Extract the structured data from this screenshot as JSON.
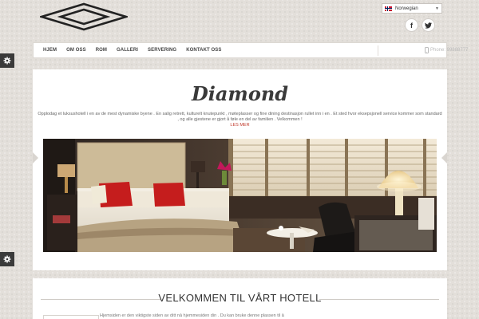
{
  "header": {
    "language": {
      "selected": "Norwegian",
      "flag_icon": "norway-flag-icon"
    },
    "social": [
      {
        "name": "facebook",
        "glyph": "f"
      },
      {
        "name": "twitter",
        "icon": "twitter-bird-icon"
      }
    ]
  },
  "nav": {
    "items": [
      "HJEM",
      "OM OSS",
      "ROM",
      "GALLERI",
      "SERVERING",
      "KONTAKT OSS"
    ],
    "phone": "Phone: 99888777"
  },
  "hero": {
    "title": "Diamond",
    "text": "Opplodag et luksushotell i en av de mest dynamiske byene . En salig retrett, kulturelt knutepunkt , møteplasser og fine dining destinasjon rullet inn i en . Et sted hvor eksepsjonell service kommer som standard , og alle gjestene er gjort å føle en del av familien . Velkommen !",
    "read_more": "LES MER"
  },
  "welcome": {
    "title": "VELKOMMEN TIL VÅRT HOTELL",
    "text": "Hjemsiden er den viktigste siden av ditt nå hjemmesiden din . Du kan bruke denne plassen til å"
  },
  "colors": {
    "background": "#e3dfda",
    "accent": "#c0392b",
    "panel": "#ffffff",
    "gear_tab": "#3a3a3a"
  }
}
